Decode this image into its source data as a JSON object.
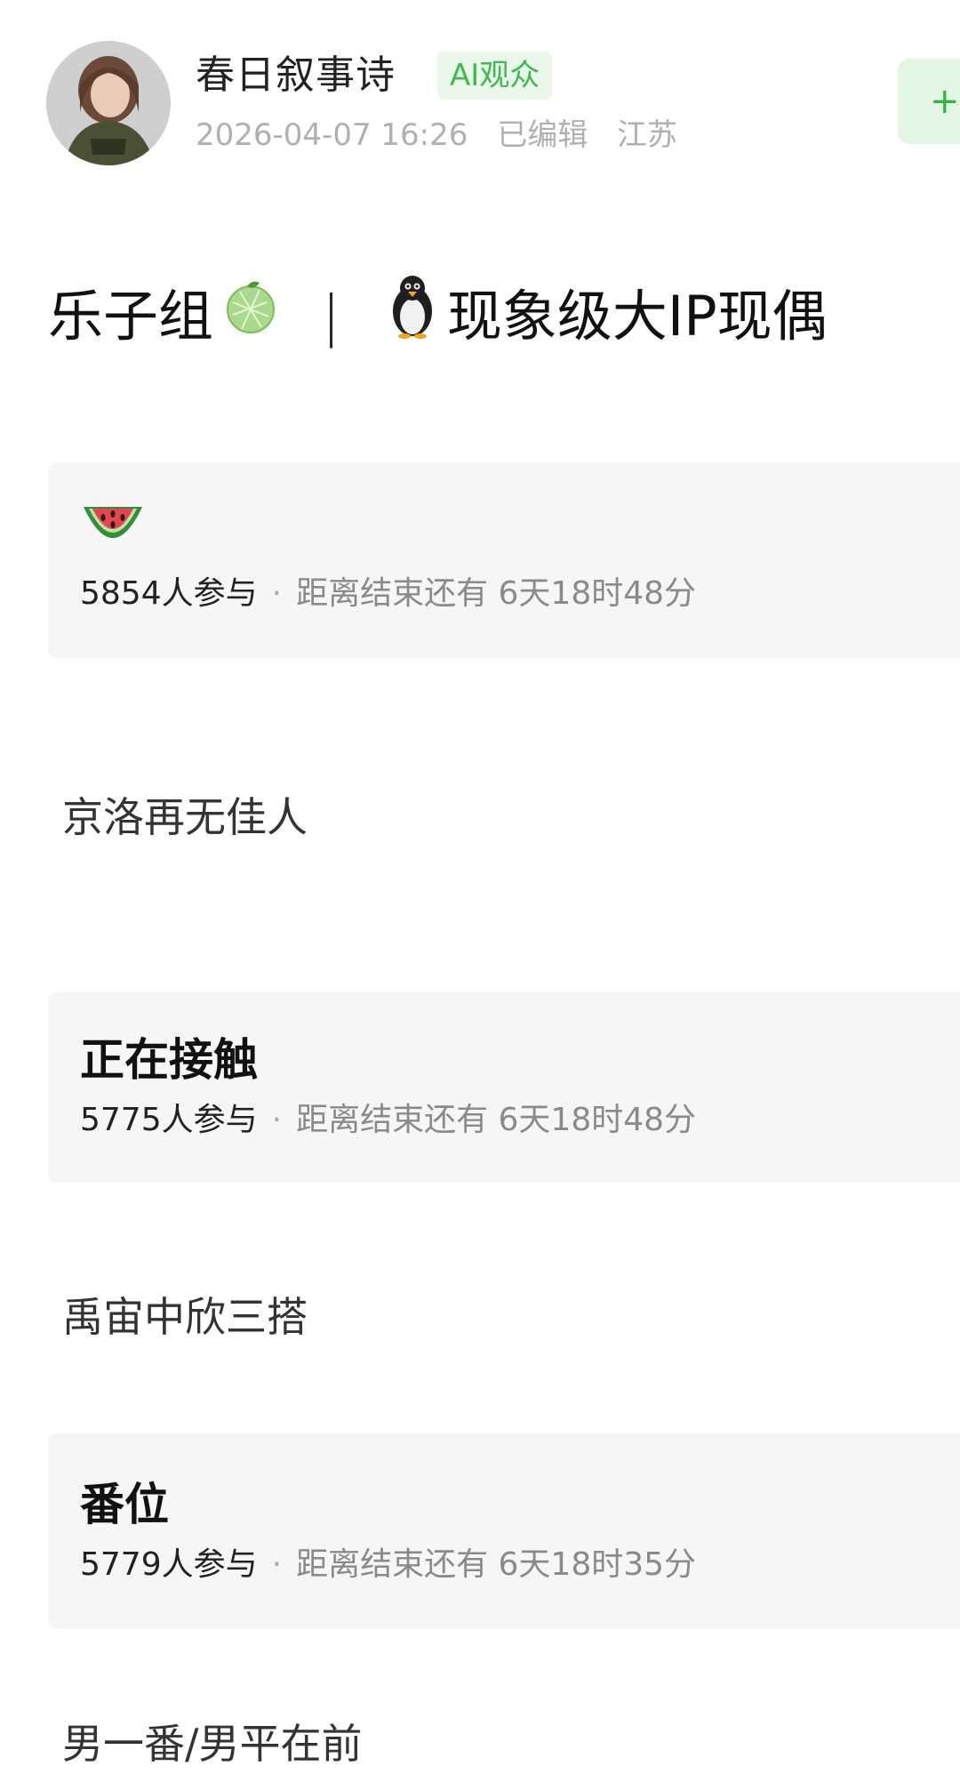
{
  "author": {
    "name": "春日叙事诗",
    "badge": "AI观众",
    "time": "2026-04-07 16:26",
    "edited": "已编辑",
    "location": "江苏",
    "follow_label": "+"
  },
  "post": {
    "title_part1": "乐子组",
    "title_icon1": "melon-emoji",
    "separator": "|",
    "title_icon2": "penguin-emoji",
    "title_part2": "现象级大IP现偶"
  },
  "polls": [
    {
      "title_icon": "watermelon-emoji",
      "title": "",
      "participants": "5854人参与",
      "remaining": "距离结束还有 6天18时48分",
      "answer": "京洛再无佳人"
    },
    {
      "title": "正在接触",
      "participants": "5775人参与",
      "remaining": "距离结束还有 6天18时48分",
      "answer": "禹宙中欣三搭"
    },
    {
      "title": "番位",
      "participants": "5779人参与",
      "remaining": "距离结束还有 6天18时35分",
      "answer": "男一番/男平在前"
    }
  ],
  "colors": {
    "accent_green": "#3dbb4e",
    "badge_bg": "#eaf7ea",
    "card_bg": "#f6f6f6"
  }
}
